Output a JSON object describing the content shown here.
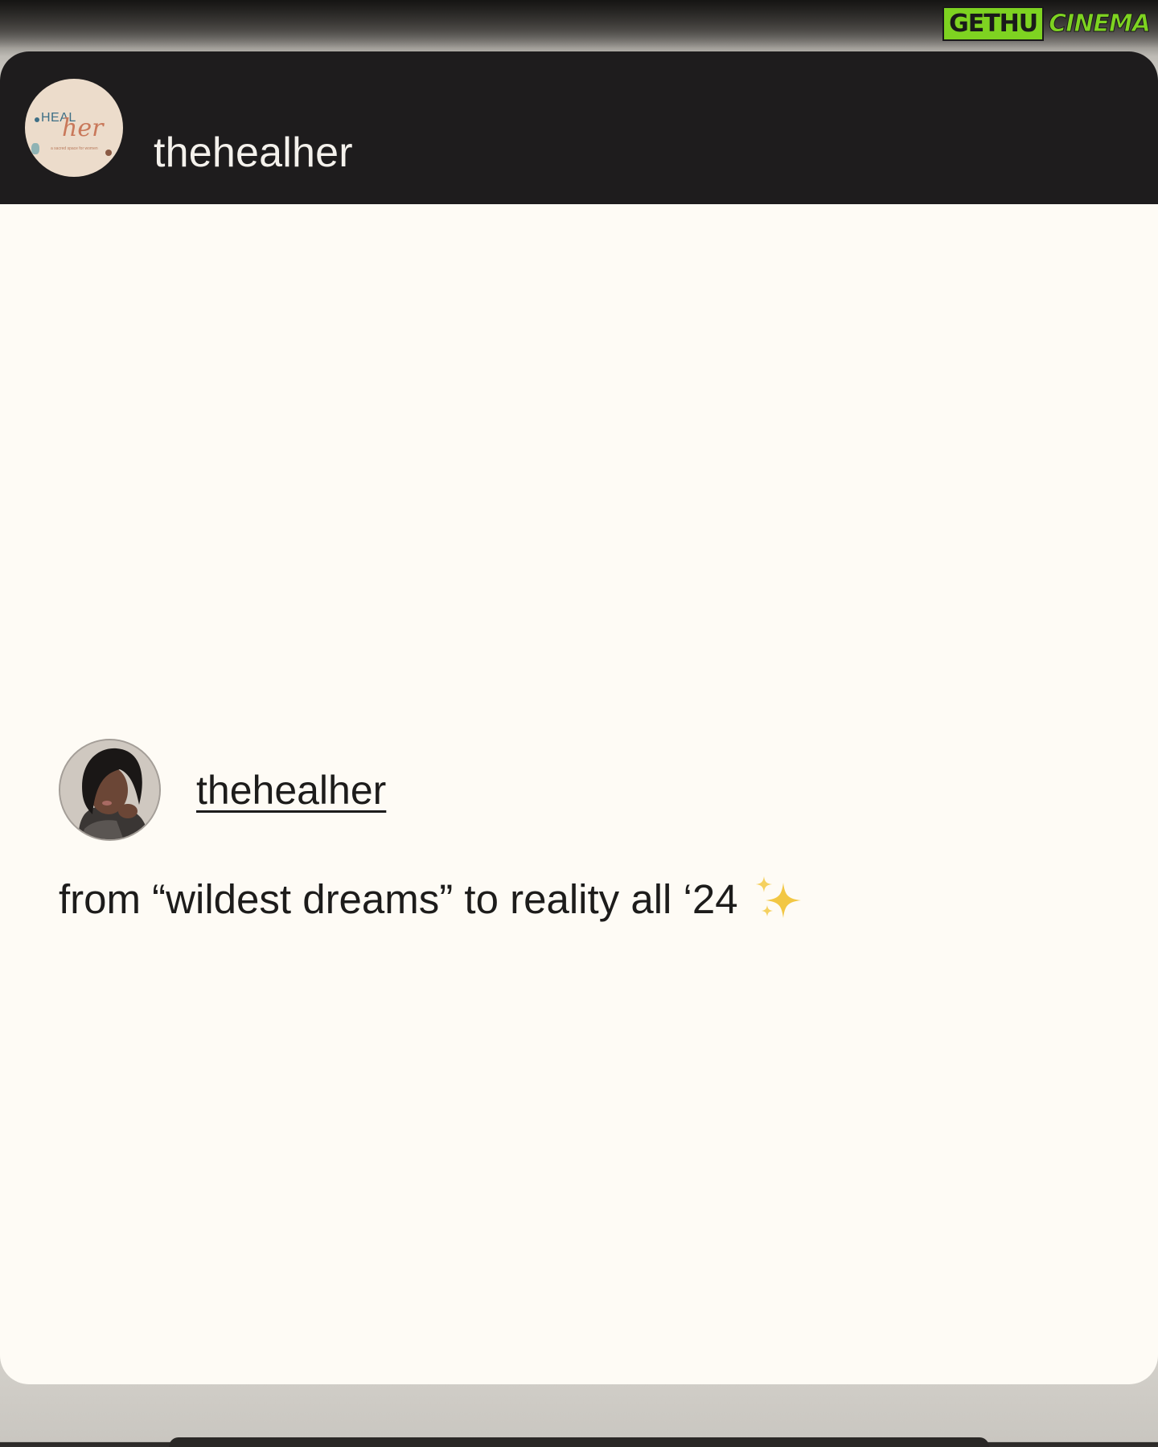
{
  "watermark": {
    "part1": "GETHU",
    "part2": "CINEMA"
  },
  "header": {
    "username": "thehealher",
    "avatar_logo": {
      "heal": "HEAL",
      "her": "her",
      "tagline": "a sacred space for women"
    }
  },
  "post": {
    "username": "thehealher",
    "caption": "from “wildest dreams” to reality all ‘24",
    "caption_emoji": "sparkles-icon"
  },
  "colors": {
    "header_bg": "#1e1c1d",
    "card_bg": "#fefbf5",
    "text": "#1d1c1b",
    "sparkle": "#f2c744",
    "watermark_green": "#7ed321"
  }
}
